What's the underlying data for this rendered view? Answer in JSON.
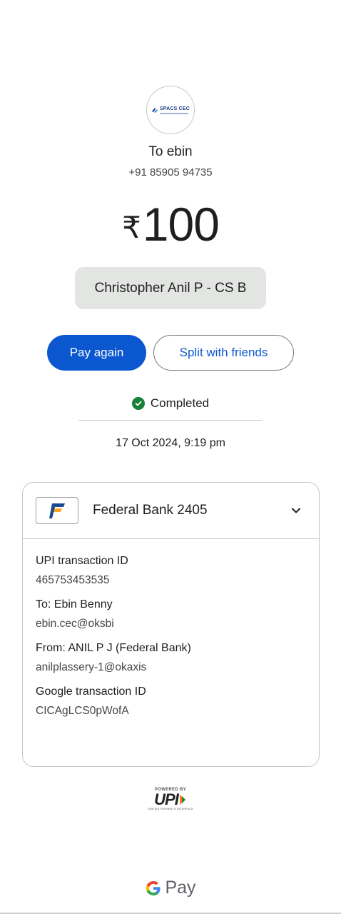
{
  "recipient": {
    "logo_text": "SPACS CEC",
    "to_label": "To ebin",
    "phone": "+91 85905 94735"
  },
  "amount": {
    "currency": "₹",
    "value": "100"
  },
  "note": "Christopher Anil P - CS B",
  "actions": {
    "pay_again": "Pay again",
    "split": "Split with friends"
  },
  "status": {
    "text": "Completed",
    "datetime": "17 Oct 2024, 9:19 pm"
  },
  "bank": {
    "name": "Federal Bank 2405"
  },
  "details": {
    "upi_id_label": "UPI transaction ID",
    "upi_id": "465753453535",
    "to_label": "To: Ebin  Benny",
    "to_vpa": "ebin.cec@oksbi",
    "from_label": "From: ANIL P J (Federal Bank)",
    "from_vpa": "anilplassery-1@okaxis",
    "google_id_label": "Google transaction ID",
    "google_id": "CICAgLCS0pWofA"
  },
  "footer": {
    "powered_by": "POWERED BY",
    "upi": "UPI",
    "upi_sub": "UNIFIED PAYMENTS INTERFACE",
    "gpay": "Pay"
  },
  "colors": {
    "primary": "#0b57d0",
    "success": "#188038",
    "note_bg": "#e3e5e3",
    "federal_blue": "#1a4a8d",
    "federal_orange": "#f5a623"
  }
}
